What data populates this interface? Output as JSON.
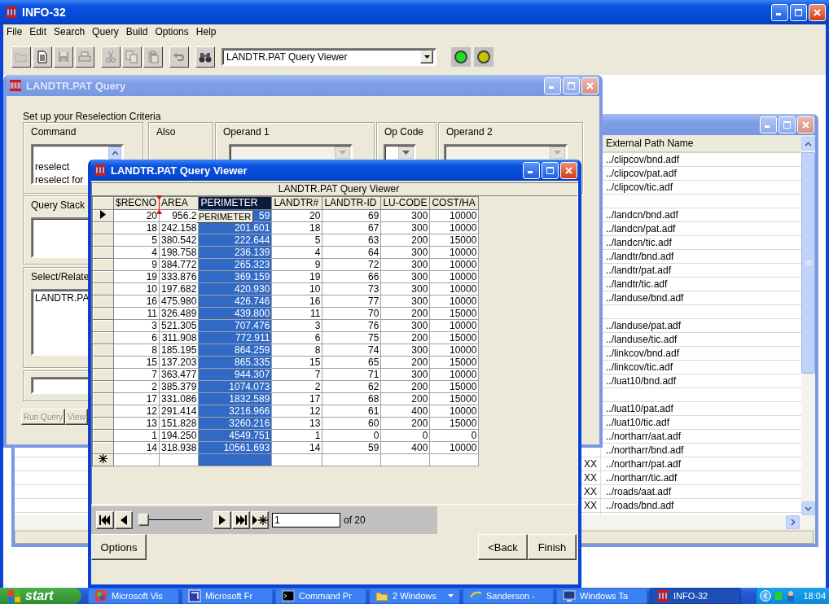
{
  "app": {
    "title": "INFO-32",
    "menu": [
      "File",
      "Edit",
      "Search",
      "Query",
      "Build",
      "Options",
      "Help"
    ],
    "toolbar": [
      {
        "kind": "open",
        "disabled": true
      },
      {
        "kind": "new",
        "disabled": false
      },
      {
        "kind": "save",
        "disabled": true
      },
      {
        "kind": "print",
        "disabled": true
      },
      {
        "kind": "cut",
        "disabled": true
      },
      {
        "kind": "copy",
        "disabled": true
      },
      {
        "kind": "paste",
        "disabled": true
      },
      {
        "kind": "undo",
        "disabled": true
      },
      {
        "kind": "find",
        "disabled": false
      }
    ],
    "view_dropdown": "LANDTR.PAT Query Viewer",
    "status_lights": [
      {
        "color": "#1ee01e"
      },
      {
        "color": "#c8c400"
      }
    ]
  },
  "file_window": {
    "active": false,
    "header": "External Path Name",
    "rows": [
      {
        "path": "../clipcov/bnd.adf"
      },
      {
        "path": "../clipcov/pat.adf"
      },
      {
        "path": "../clipcov/tic.adf"
      },
      {},
      {
        "path": "../landcn/bnd.adf"
      },
      {
        "path": "../landcn/pat.adf"
      },
      {
        "path": "../landcn/tic.adf"
      },
      {
        "path": "../landtr/bnd.adf"
      },
      {
        "path": "../landtr/pat.adf"
      },
      {
        "path": "../landtr/tic.adf"
      },
      {
        "path": "../landuse/bnd.adf"
      },
      {},
      {
        "path": "../landuse/pat.adf"
      },
      {
        "path": "../landuse/tic.adf"
      },
      {
        "path": "../linkcov/bnd.adf"
      },
      {
        "path": "../linkcov/tic.adf"
      },
      {
        "path": "../luat10/bnd.adf"
      },
      {},
      {
        "path": "../luat10/pat.adf"
      },
      {
        "path": "../luat10/tic.adf"
      },
      {
        "path": "../northarr/aat.adf"
      },
      {
        "path": "../northarr/bnd.adf"
      },
      {
        "column_1": "XX",
        "path": "../northarr/pat.adf"
      },
      {
        "column_1": "XX",
        "path": "../northarr/tic.adf"
      },
      {
        "column_1": "XX",
        "path": "../roads/aat.adf"
      },
      {
        "column_1": "XX",
        "path": "../roads/bnd.adf"
      }
    ]
  },
  "query_window": {
    "title": "LANDTR.PAT Query",
    "active": false,
    "heading": "Set up your Reselection Criteria",
    "command": {
      "label": "Command",
      "items": [
        "reselect",
        "reselect for"
      ]
    },
    "also": {
      "label": "Also"
    },
    "operand_1": {
      "label": "Operand 1",
      "disabled": true
    },
    "op_code": {
      "label": "Op Code",
      "disabled": false
    },
    "operand_2": {
      "label": "Operand 2",
      "disabled": true
    },
    "query_stack": {
      "label": "Query Stack"
    },
    "select_relate": {
      "label": "Select/Relate",
      "items": [
        "LANDTR.PA"
      ]
    },
    "buttons": [
      {
        "label": "Run Query",
        "disabled": true
      },
      {
        "label": "View",
        "disabled": true
      }
    ]
  },
  "viewer_window": {
    "title": "LANDTR.PAT Query Viewer",
    "active": true,
    "caption": "LANDTR.PAT Query Viewer",
    "columns": [
      {
        "label": "$RECNO",
        "selected": false
      },
      {
        "label": "AREA",
        "selected": false
      },
      {
        "label": "PERIMETER",
        "selected": true
      },
      {
        "label": "LANDTR#",
        "selected": false
      },
      {
        "label": "LANDTR-ID",
        "selected": false
      },
      {
        "label": "LU-CODE",
        "selected": false
      },
      {
        "label": "COST/HA",
        "selected": false
      }
    ],
    "rows": [
      {
        "current": true,
        "cells": [
          "20",
          "956.2",
          "59",
          "20",
          "69",
          "300",
          "10000"
        ]
      },
      {
        "current": false,
        "cells": [
          "18",
          "242.158",
          "201.601",
          "18",
          "67",
          "300",
          "10000"
        ]
      },
      {
        "current": false,
        "cells": [
          "5",
          "380.542",
          "222.644",
          "5",
          "63",
          "200",
          "15000"
        ]
      },
      {
        "current": false,
        "cells": [
          "4",
          "198.758",
          "236.139",
          "4",
          "64",
          "300",
          "10000"
        ]
      },
      {
        "current": false,
        "cells": [
          "9",
          "384.772",
          "265.323",
          "9",
          "72",
          "300",
          "10000"
        ]
      },
      {
        "current": false,
        "cells": [
          "19",
          "333.876",
          "369.159",
          "19",
          "66",
          "300",
          "10000"
        ]
      },
      {
        "current": false,
        "cells": [
          "10",
          "197.682",
          "420.930",
          "10",
          "73",
          "300",
          "10000"
        ]
      },
      {
        "current": false,
        "cells": [
          "16",
          "475.980",
          "426.746",
          "16",
          "77",
          "300",
          "10000"
        ]
      },
      {
        "current": false,
        "cells": [
          "11",
          "326.489",
          "439.800",
          "11",
          "70",
          "200",
          "15000"
        ]
      },
      {
        "current": false,
        "cells": [
          "3",
          "521.305",
          "707.476",
          "3",
          "76",
          "300",
          "10000"
        ]
      },
      {
        "current": false,
        "cells": [
          "6",
          "311.908",
          "772.911",
          "6",
          "75",
          "200",
          "15000"
        ]
      },
      {
        "current": false,
        "cells": [
          "8",
          "185.195",
          "864.259",
          "8",
          "74",
          "300",
          "10000"
        ]
      },
      {
        "current": false,
        "cells": [
          "15",
          "137.203",
          "865.335",
          "15",
          "65",
          "200",
          "15000"
        ]
      },
      {
        "current": false,
        "cells": [
          "7",
          "363.477",
          "944.307",
          "7",
          "71",
          "300",
          "10000"
        ]
      },
      {
        "current": false,
        "cells": [
          "2",
          "385.379",
          "1074.073",
          "2",
          "62",
          "200",
          "15000"
        ]
      },
      {
        "current": false,
        "cells": [
          "17",
          "331.086",
          "1832.589",
          "17",
          "68",
          "200",
          "15000"
        ]
      },
      {
        "current": false,
        "cells": [
          "12",
          "291.414",
          "3216.966",
          "12",
          "61",
          "400",
          "10000"
        ]
      },
      {
        "current": false,
        "cells": [
          "13",
          "151.828",
          "3260.216",
          "13",
          "60",
          "200",
          "15000"
        ]
      },
      {
        "current": false,
        "cells": [
          "1",
          "194.250",
          "4549.751",
          "1",
          "0",
          "0",
          "0"
        ]
      },
      {
        "current": false,
        "cells": [
          "14",
          "318.938",
          "10561.693",
          "14",
          "59",
          "400",
          "10000"
        ]
      }
    ],
    "drag_tooltip": "PERIMETER",
    "navigator": {
      "level": 0,
      "record": "1",
      "count": "of 20"
    },
    "buttons": [
      {
        "label": "Options"
      },
      {
        "label": "<Back"
      },
      {
        "label": "Finish"
      }
    ]
  },
  "taskbar": {
    "start": "start",
    "items": [
      {
        "kind": "paint",
        "label": "Microsoft Vis",
        "selected": false
      },
      {
        "kind": "frame",
        "label": "Microsoft Fr",
        "selected": false
      },
      {
        "kind": "console",
        "label": "Command Pr",
        "selected": false
      },
      {
        "kind": "folder",
        "label": "2 Windows",
        "selected": false
      },
      {
        "kind": "browser",
        "label": "Sanderson -",
        "selected": false
      },
      {
        "kind": "monitor",
        "label": "Windows Ta",
        "selected": false
      },
      {
        "kind": "pillars",
        "label": "INFO-32",
        "selected": true
      }
    ],
    "clock": "18:04"
  }
}
